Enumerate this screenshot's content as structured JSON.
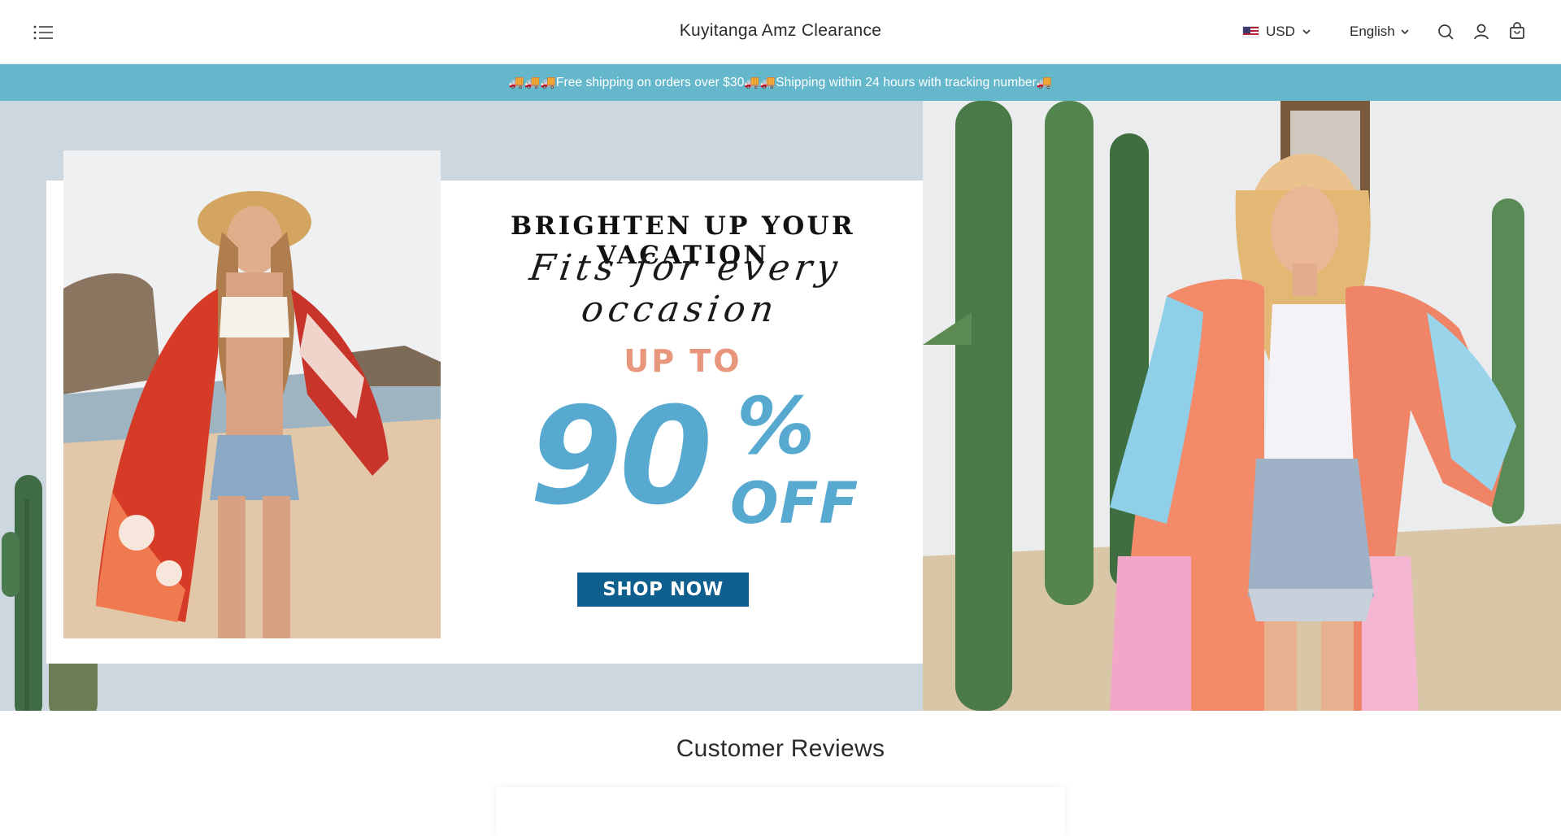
{
  "header": {
    "title": "Kuyitanga Amz Clearance",
    "currency": "USD",
    "language": "English",
    "icons": [
      "menu-icon",
      "search-icon",
      "account-icon",
      "cart-icon",
      "chevron-down-icon"
    ]
  },
  "announcement": {
    "text": "🚚🚚🚚Free shipping on orders over $30🚚🚚Shipping within 24 hours with tracking number🚚"
  },
  "hero": {
    "headline": "BRIGHTEN UP YOUR VACATION",
    "script_tagline": "Fits for every occasion",
    "up_to": "UP TO",
    "discount_number": "90",
    "percent_sign": "%",
    "off": "OFF",
    "cta_label": "SHOP NOW"
  },
  "reviews": {
    "title": "Customer Reviews"
  },
  "colors": {
    "announcement_bg": "#65b8cb",
    "hero_bg": "#ccd7df",
    "discount_blue": "#57a9cf",
    "up_to_coral": "#e8967c",
    "cta_bg": "#0f5f8e"
  }
}
